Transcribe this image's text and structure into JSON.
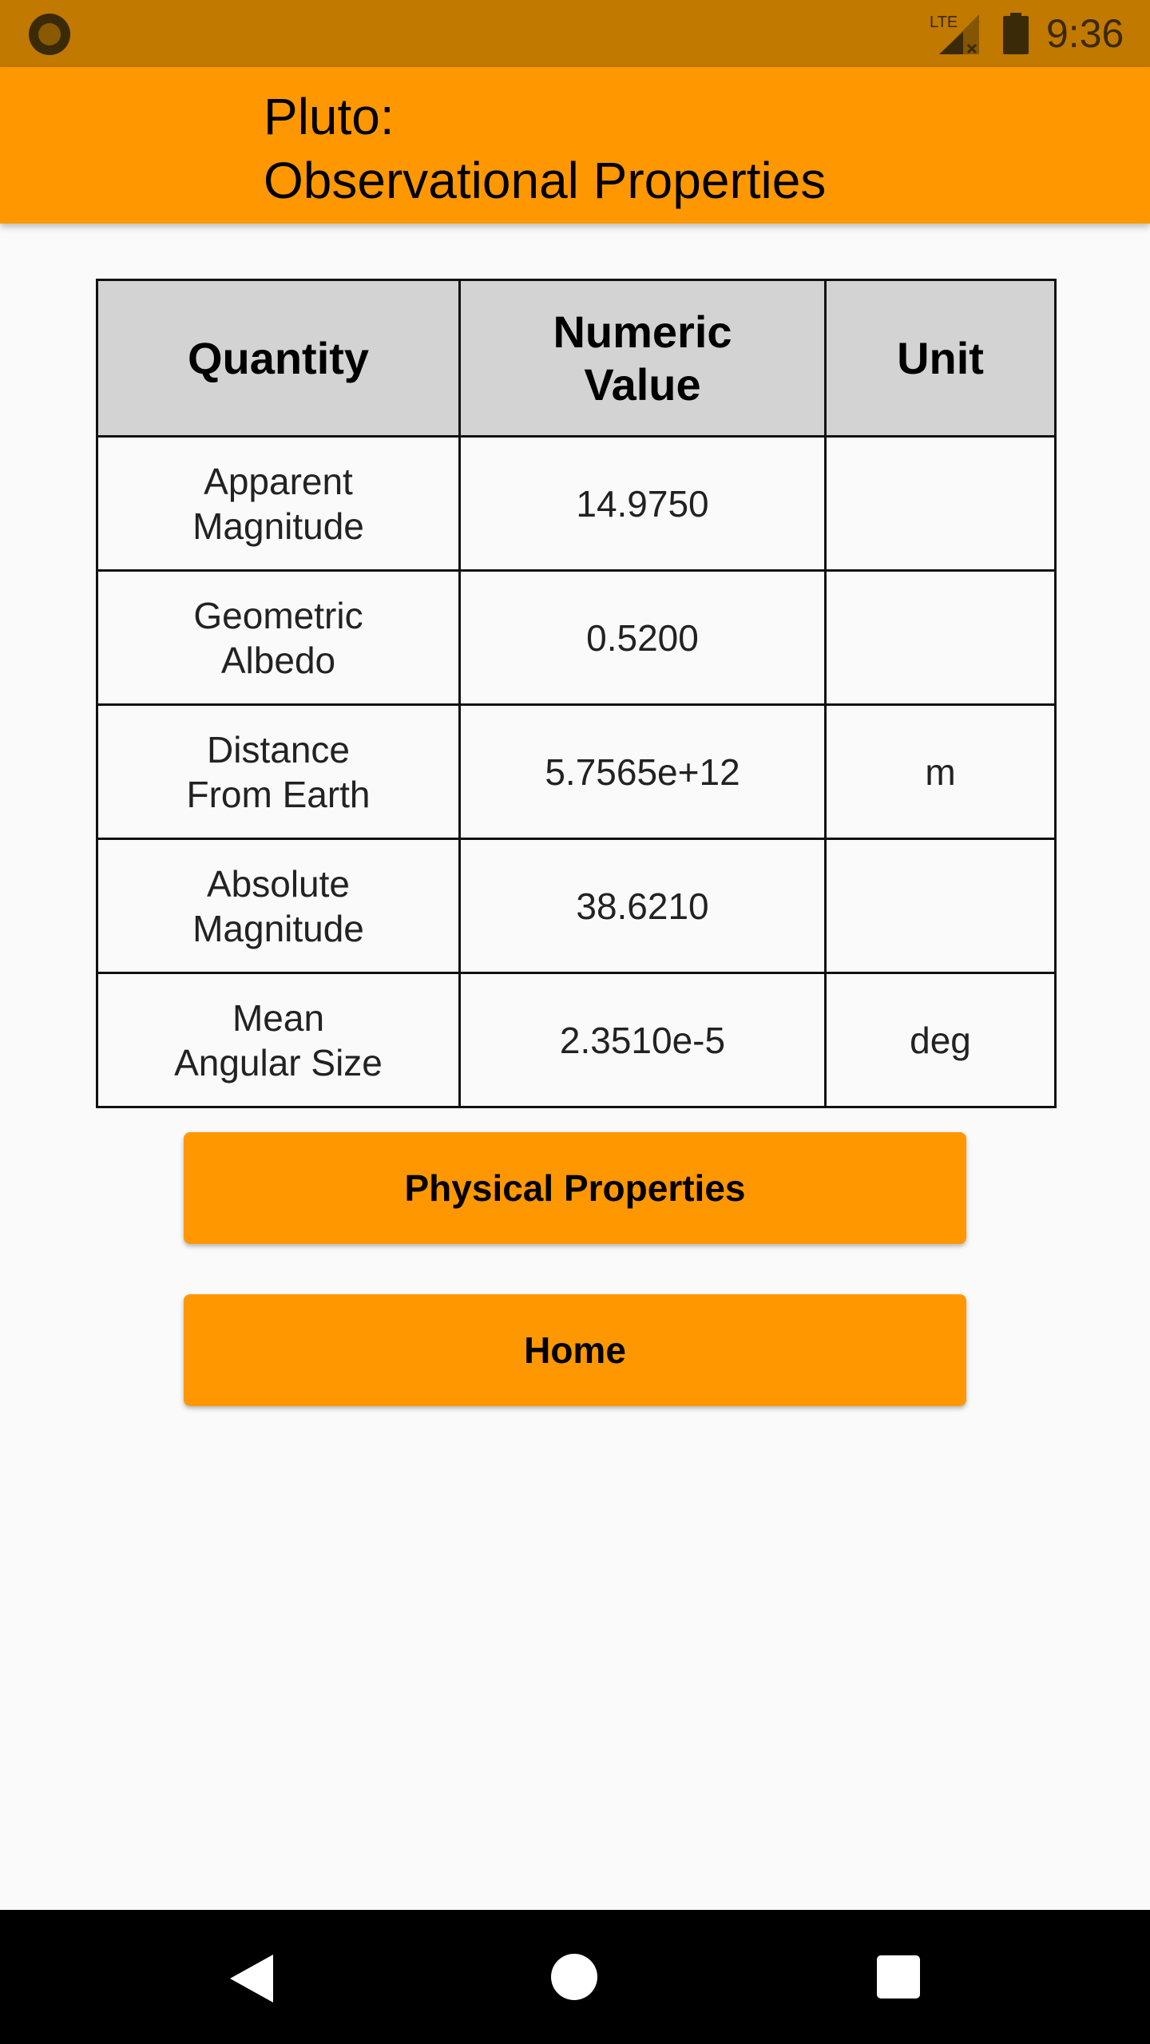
{
  "status_bar": {
    "time": "9:36",
    "network_label": "LTE",
    "icons": [
      "app-notification-icon",
      "lte-signal-icon",
      "battery-icon"
    ]
  },
  "app_bar": {
    "title": "Pluto:\nObservational Properties"
  },
  "table": {
    "headers": {
      "quantity": "Quantity",
      "value": "Numeric\nValue",
      "unit": "Unit"
    },
    "rows": [
      {
        "quantity": "Apparent\nMagnitude",
        "value": "14.9750",
        "unit": ""
      },
      {
        "quantity": "Geometric\nAlbedo",
        "value": "0.5200",
        "unit": ""
      },
      {
        "quantity": "Distance\nFrom Earth",
        "value": "5.7565e+12",
        "unit": "m"
      },
      {
        "quantity": "Absolute\nMagnitude",
        "value": "38.6210",
        "unit": ""
      },
      {
        "quantity": "Mean\nAngular Size",
        "value": "2.3510e-5",
        "unit": "deg"
      }
    ]
  },
  "buttons": {
    "physical_properties": "Physical Properties",
    "home": "Home"
  },
  "nav_bar": {
    "icons": [
      "back-icon",
      "home-circle-icon",
      "recents-square-icon"
    ]
  },
  "colors": {
    "status_bar": "#c17900",
    "accent": "#ff9800",
    "table_header": "#d3d3d3",
    "background": "#fafafa",
    "nav_bar": "#000000"
  }
}
